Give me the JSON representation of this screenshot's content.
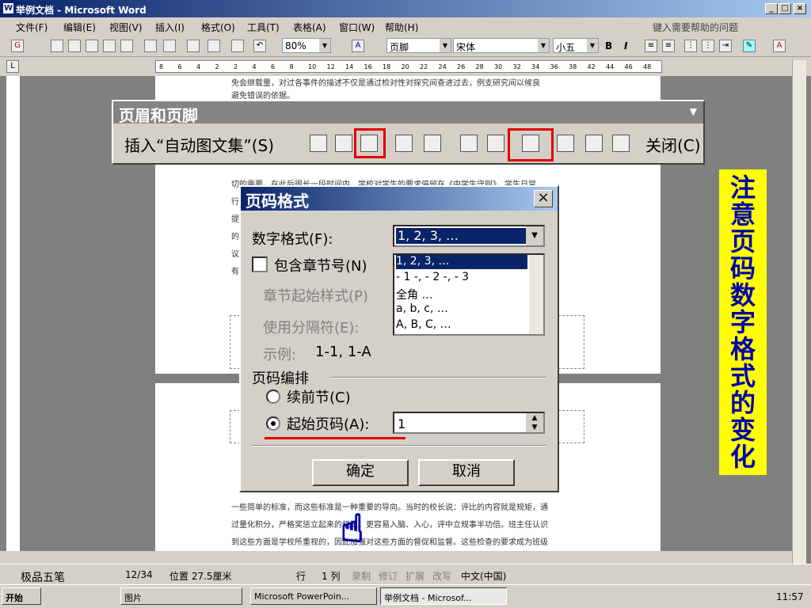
{
  "window": {
    "title": "举例文档 - Microsoft Word",
    "app_icon": "W"
  },
  "menu": {
    "items": [
      "文件(F)",
      "编辑(E)",
      "视图(V)",
      "插入(I)",
      "格式(O)",
      "工具(T)",
      "表格(A)",
      "窗口(W)",
      "帮助(H)"
    ],
    "help_placeholder": "键入需要帮助的问题"
  },
  "toolbar": {
    "zoom": "80%",
    "style": "页脚",
    "font": "宋体",
    "size": "小五",
    "bold": "B",
    "italic": "I"
  },
  "ruler": {
    "ticks": [
      "8",
      "6",
      "4",
      "2",
      "2",
      "4",
      "6",
      "8",
      "10",
      "12",
      "14",
      "16",
      "18",
      "20",
      "22",
      "24",
      "26",
      "28",
      "30",
      "32",
      "34",
      "36",
      "38",
      "42",
      "44",
      "46",
      "48"
    ]
  },
  "document": {
    "top_text_1": "免会继载量，对过各事件的描述不仅是通过检对性对探究间查进过去，例支研究间以候良",
    "top_text_2": "避免错误的依据。",
    "bg_lines": [
      "切的需要，在此后很长一段时间内，学校对学生的要求停留在《中学生守则》，学生日常",
      "行",
      "提",
      "的",
      "议",
      "有"
    ],
    "bottom_text": [
      "一些简单的标准，而这些标准是一种重要的导向。当时的校长说：评比的内容就是规矩，通",
      "过量化积分，严格奖惩立起来的规矩，更容易入脑、入心，评中立规事半功倍。班主任认识",
      "到这些方面是学校所重视的，因此加强对这些方面的督促和监督。这些检查的要求成为班级"
    ]
  },
  "hf_toolbar": {
    "title": "页眉和页脚",
    "insert_autotext": "插入“自动图文集”(S)",
    "close": "关闭(C)"
  },
  "dialog": {
    "title": "页码格式",
    "number_format_label": "数字格式(F):",
    "number_format_value": "1, 2, 3, …",
    "include_chapter_label": "包含章节号(N)",
    "chapter_style_label": "章节起始样式(P)",
    "separator_label": "使用分隔符(E):",
    "example_label": "示例:",
    "example_value": "1-1, 1-A",
    "numbering_group": "页码编排",
    "continue_label": "续前节(C)",
    "start_at_label": "起始页码(A):",
    "start_at_value": "1",
    "list_options": [
      "1, 2, 3, …",
      "- 1 -, - 2 -, - 3",
      "全角 …",
      "a, b, c, …",
      "A, B, C, …"
    ],
    "ok": "确定",
    "cancel": "取消"
  },
  "annotation": "注意页码数字格式的变化",
  "status": {
    "ime": "极品五笔",
    "page": "12/34",
    "position": "位置 27.5厘米",
    "row": "行",
    "col": "1 列",
    "rec": "录制",
    "trk": "修订",
    "ext": "扩展",
    "ovr": "改写",
    "lang": "中文(中国)"
  },
  "taskbar": {
    "start": "开始",
    "folder": "图片",
    "tasks": [
      "Microsoft PowerPoin...",
      "举例文档 - Microsof..."
    ],
    "clock": "11:57"
  },
  "colors": {
    "highlight": "#e00000",
    "note_bg": "#ffff00",
    "note_text": "#0000aa"
  }
}
